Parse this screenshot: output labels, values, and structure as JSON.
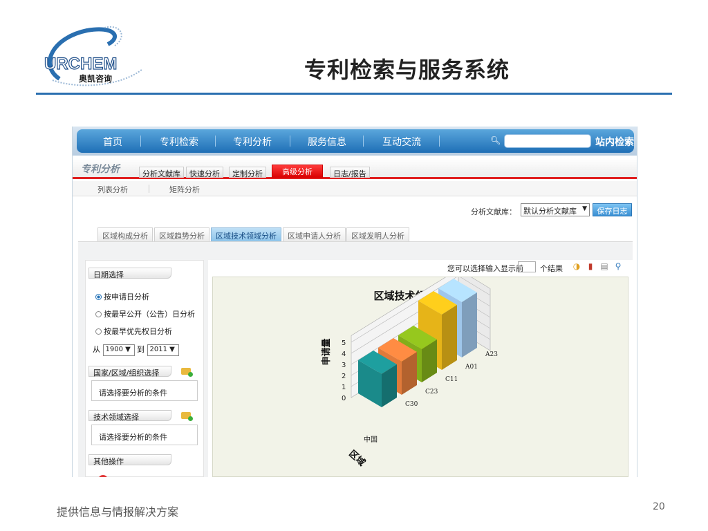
{
  "slide": {
    "title": "专利检索与服务系统",
    "logo_text": "URCHEM",
    "logo_subtext": "奥凯咨询",
    "footer": "提供信息与情报解决方案",
    "page_number": "20"
  },
  "navbar": {
    "items": [
      "首页",
      "专利检索",
      "专利分析",
      "服务信息",
      "互动交流"
    ],
    "site_search": "站内检索"
  },
  "module": {
    "title": "专利分析",
    "tabs": [
      "分析文献库",
      "快速分析",
      "定制分析",
      "高级分析",
      "日志/报告"
    ],
    "active_tab": "高级分析"
  },
  "sub_links": [
    "列表分析",
    "矩阵分析"
  ],
  "library": {
    "label": "分析文献库：",
    "selected": "默认分析文献库",
    "save_button": "保存日志"
  },
  "analysis_tabs": [
    "区域构成分析",
    "区域趋势分析",
    "区域技术领域分析",
    "区域申请人分析",
    "区域发明人分析"
  ],
  "sidebar": {
    "date_section": "日期选择",
    "date_options": [
      "按申请日分析",
      "按最早公开（公告）日分析",
      "按最早优先权日分析"
    ],
    "from_label": "从",
    "from_year": "1900",
    "to_label": "到",
    "to_year": "2011",
    "country_section": "国家/区域/组织选择",
    "country_placeholder": "请选择要分析的条件",
    "tech_section": "技术领域选择",
    "tech_placeholder": "请选择要分析的条件",
    "other_section": "其他操作"
  },
  "topn": {
    "label": "您可以选择输入显示前",
    "suffix": "个结果"
  },
  "colors": {
    "nav_blue": "#1f6fb6",
    "active_red": "#d80000",
    "header_rule": "#2a6fb0"
  },
  "chart_data": {
    "type": "bar",
    "title": "区域技术领域分析图",
    "ylabel": "申请量",
    "xlabel": "区域",
    "ylim": [
      0,
      5
    ],
    "y_ticks": [
      0,
      1,
      2,
      3,
      4,
      5
    ],
    "region": "中国",
    "categories": [
      "C30",
      "C23",
      "C11",
      "A01",
      "A23"
    ],
    "series": [
      {
        "values": [
          3,
          3,
          3,
          5,
          5
        ]
      }
    ],
    "bar_colors": [
      "#1a8a8a",
      "#e07a3a",
      "#82ae1a",
      "#e6b418",
      "#9fc6ea"
    ],
    "grid": true,
    "projection": "3d"
  }
}
